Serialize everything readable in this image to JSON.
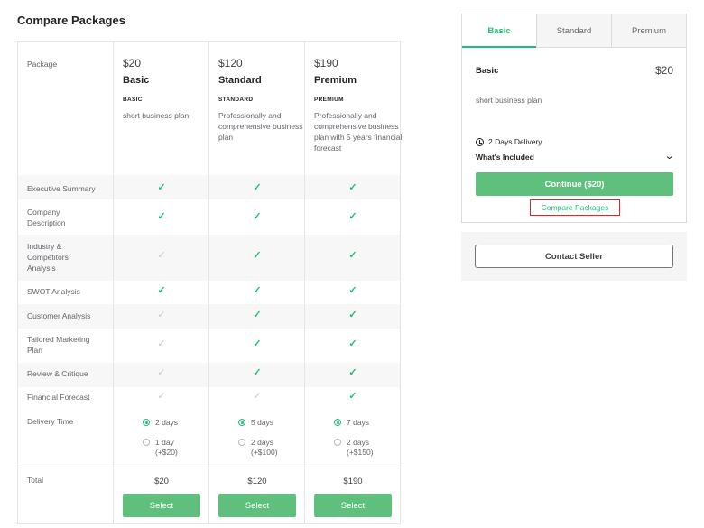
{
  "title": "Compare Packages",
  "table": {
    "package_label": "Package",
    "packages": [
      {
        "price": "$20",
        "name": "Basic",
        "tag": "BASIC",
        "desc": "short business plan"
      },
      {
        "price": "$120",
        "name": "Standard",
        "tag": "STANDARD",
        "desc": "Professionally and comprehensive business plan"
      },
      {
        "price": "$190",
        "name": "Premium",
        "tag": "PREMIUM",
        "desc": "Professionally and comprehensive business plan with 5 years financial forecast"
      }
    ],
    "features": [
      {
        "label": "Executive Summary",
        "included": [
          true,
          true,
          true
        ]
      },
      {
        "label": "Company Description",
        "included": [
          true,
          true,
          true
        ]
      },
      {
        "label": "Industry & Competitors' Analysis",
        "included": [
          false,
          true,
          true
        ]
      },
      {
        "label": "SWOT Analysis",
        "included": [
          true,
          true,
          true
        ]
      },
      {
        "label": "Customer Analysis",
        "included": [
          false,
          true,
          true
        ]
      },
      {
        "label": "Tailored Marketing Plan",
        "included": [
          false,
          true,
          true
        ]
      },
      {
        "label": "Review & Critique",
        "included": [
          false,
          true,
          true
        ]
      },
      {
        "label": "Financial Forecast",
        "included": [
          false,
          false,
          true
        ]
      }
    ],
    "check_glyph": "✓",
    "delivery_label": "Delivery Time",
    "delivery": [
      {
        "selected": "2 days",
        "alt": "1 day",
        "alt_extra": "(+$20)"
      },
      {
        "selected": "5 days",
        "alt": "2 days",
        "alt_extra": "(+$100)"
      },
      {
        "selected": "7 days",
        "alt": "2 days",
        "alt_extra": "(+$150)"
      }
    ],
    "total_label": "Total",
    "totals": [
      "$20",
      "$120",
      "$190"
    ],
    "select_label": "Select"
  },
  "panel": {
    "tabs": [
      "Basic",
      "Standard",
      "Premium"
    ],
    "active_tab": "Basic",
    "name": "Basic",
    "price": "$20",
    "desc": "short business plan",
    "delivery": "2 Days Delivery",
    "included": "What's Included",
    "chevron": "⌄",
    "continue": "Continue ($20)",
    "compare": "Compare Packages",
    "contact": "Contact Seller"
  },
  "colors": {
    "accent": "#1dbf73",
    "button": "#5fbf7c",
    "highlight_box": "#e0262b"
  }
}
